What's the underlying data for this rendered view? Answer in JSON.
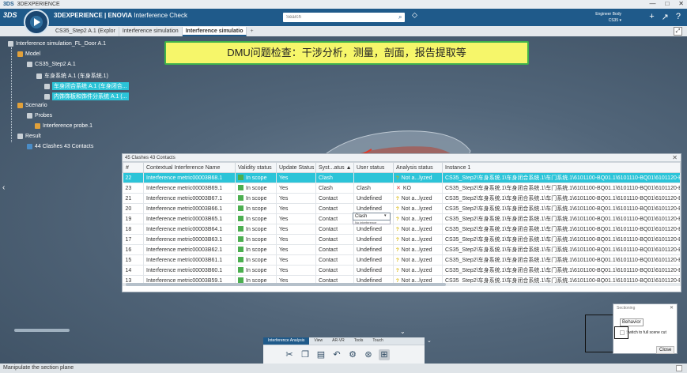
{
  "window": {
    "title": "3DEXPERIENCE",
    "controls": [
      "—",
      "□",
      "✕"
    ]
  },
  "appbar": {
    "brand_bold": "3DEXPERIENCE | ENOVIA",
    "brand_app": "Interference Check",
    "search_placeholder": "Search",
    "user_line1": "Engineer Body",
    "user_line2": "CS35 ▾",
    "icons": [
      "add-icon",
      "share-icon",
      "help-icon"
    ]
  },
  "tabs": [
    {
      "label": "CS35_Step2 A.1 (Explor",
      "active": false
    },
    {
      "label": "Interference simulation",
      "active": false
    },
    {
      "label": "Interference simulatio",
      "active": true
    }
  ],
  "tab_add": "+",
  "tree": {
    "root": "Interference simulation_FL_Door A.1",
    "model": "Model",
    "cs35": "CS35_Step2 A.1",
    "sub1": "车身系统 A.1 (车身系统.1)",
    "sub2": "车身闭合系统 A.1 (车身闭合...",
    "sub3": "内饰饰板和饰件分系统 A.1 (...",
    "scenario": "Scenario",
    "probes": "Probes",
    "probe1": "Interference probe.1",
    "result": "Result",
    "result_item": "44 Clashes  43 Contacts"
  },
  "banner": "DMU问题检查：干涉分析，测量，剖面，报告提取等",
  "panel": {
    "header": "45 Clashes  43 Contacts",
    "columns": [
      "#",
      "Contextual Interference Name",
      "Validity status",
      "Update Status",
      "Syst...atus ▲",
      "User status",
      "Analysis status",
      "Instance 1"
    ],
    "rows": [
      {
        "num": "22",
        "name": "Interference metric00003B68.1",
        "validity": "In scope",
        "update": "Yes",
        "system": "Clash",
        "user": "",
        "analysis": "Not a...lyzed",
        "analysis_icon": "q",
        "instance": "CS35_Step2\\车身系统.1\\车身闭合系统.1\\车门系统.1\\6101100-BQ01.1\\6101110-BQ01\\6101120-BQ01.1",
        "selected": true
      },
      {
        "num": "23",
        "name": "Interference metric00003B69.1",
        "validity": "In scope",
        "update": "Yes",
        "system": "Clash",
        "user": "Clash",
        "analysis": "KO",
        "analysis_icon": "x",
        "instance": "CS35_Step2\\车身系统.1\\车身闭合系统.1\\车门系统.1\\6101100-BQ01.1\\6101110-BQ01\\6101120-BQ01.1",
        "selected": false
      },
      {
        "num": "21",
        "name": "Interference metric00003B67.1",
        "validity": "In scope",
        "update": "Yes",
        "system": "Contact",
        "user": "Undefined",
        "analysis": "Not a...lyzed",
        "analysis_icon": "q",
        "instance": "CS35_Step2\\车身系统.1\\车身闭合系统.1\\车门系统.1\\6101100-BQ01.1\\6101110-BQ01\\6101120-BQ01.1",
        "selected": false
      },
      {
        "num": "20",
        "name": "Interference metric00003B66.1",
        "validity": "In scope",
        "update": "Yes",
        "system": "Contact",
        "user": "Undefined",
        "analysis": "Not a...lyzed",
        "analysis_icon": "q",
        "instance": "CS35_Step2\\车身系统.1\\车身闭合系统.1\\车门系统.1\\6101100-BQ01.1\\6101110-BQ01\\6101120-BQ01.1",
        "selected": false
      },
      {
        "num": "19",
        "name": "Interference metric00003B65.1",
        "validity": "In scope",
        "update": "Yes",
        "system": "Contact",
        "user": "Undefined",
        "analysis": "Not a...lyzed",
        "analysis_icon": "q",
        "instance": "CS35_Step2\\车身系统.1\\车身闭合系统.1\\车门系统.1\\6101100-BQ01.1\\6101110-BQ01\\6101120-BQ01.1",
        "selected": false
      },
      {
        "num": "18",
        "name": "Interference metric00003B64.1",
        "validity": "In scope",
        "update": "Yes",
        "system": "Contact",
        "user": "Undefined",
        "analysis": "Not a...lyzed",
        "analysis_icon": "q",
        "instance": "CS35_Step2\\车身系统.1\\车身闭合系统.1\\车门系统.1\\6101100-BQ01.1\\6101110-BQ01\\6101120-BQ01.1",
        "selected": false
      },
      {
        "num": "17",
        "name": "Interference metric00003B63.1",
        "validity": "In scope",
        "update": "Yes",
        "system": "Contact",
        "user": "Undefined",
        "analysis": "Not a...lyzed",
        "analysis_icon": "q",
        "instance": "CS35_Step2\\车身系统.1\\车身闭合系统.1\\车门系统.1\\6101100-BQ01.1\\6101110-BQ01\\6101120-BQ01.1",
        "selected": false
      },
      {
        "num": "16",
        "name": "Interference metric00003B62.1",
        "validity": "In scope",
        "update": "Yes",
        "system": "Contact",
        "user": "Undefined",
        "analysis": "Not a...lyzed",
        "analysis_icon": "q",
        "instance": "CS35_Step2\\车身系统.1\\车身闭合系统.1\\车门系统.1\\6101100-BQ01.1\\6101110-BQ01\\6101120-BQ01.1",
        "selected": false
      },
      {
        "num": "15",
        "name": "Interference metric00003B61.1",
        "validity": "In scope",
        "update": "Yes",
        "system": "Contact",
        "user": "Undefined",
        "analysis": "Not a...lyzed",
        "analysis_icon": "q",
        "instance": "CS35_Step2\\车身系统.1\\车身闭合系统.1\\车门系统.1\\6101100-BQ01.1\\6101110-BQ01\\6101120-BQ01.1",
        "selected": false
      },
      {
        "num": "14",
        "name": "Interference metric00003B60.1",
        "validity": "In scope",
        "update": "Yes",
        "system": "Contact",
        "user": "Undefined",
        "analysis": "Not a...lyzed",
        "analysis_icon": "q",
        "instance": "CS35_Step2\\车身系统.1\\车身闭合系统.1\\车门系统.1\\6101100-BQ01.1\\6101110-BQ01\\6101120-BQ01.1",
        "selected": false
      },
      {
        "num": "13",
        "name": "Interference metric00003B59.1",
        "validity": "In scope",
        "update": "Yes",
        "system": "Contact",
        "user": "Undefined",
        "analysis": "Not a...lyzed",
        "analysis_icon": "q",
        "instance": "CS35_Step2\\车身系统.1\\车身闭合系统.1\\车门系统.1\\6101100-BQ01.1\\6101110-BQ01\\6101120-BQ01.1",
        "selected": false
      }
    ],
    "user_status_dropdown": {
      "value": "Clash",
      "next_option": "No interference"
    }
  },
  "actionbar": {
    "tabs": [
      {
        "label": "Interference Analysis",
        "active": true
      },
      {
        "label": "View",
        "active": false
      },
      {
        "label": "AR-VR",
        "active": false
      },
      {
        "label": "Tools",
        "active": false
      },
      {
        "label": "Touch",
        "active": false
      }
    ],
    "tools": [
      "scissors-icon",
      "copy-icon",
      "paste-icon",
      "undo-icon",
      "settings-icon",
      "probe-icon",
      "grid-icon"
    ]
  },
  "sectioning": {
    "title": "Sectioning",
    "tab": "Behavior",
    "option": "Switch to full scene cut",
    "close_label": "Close"
  },
  "status": {
    "text": "Manipulate the section plane"
  },
  "colors": {
    "appbar": "#1f5a8a",
    "selection": "#2cc4d8",
    "banner": "#f6f66a",
    "banner_border": "#3fb24b"
  }
}
